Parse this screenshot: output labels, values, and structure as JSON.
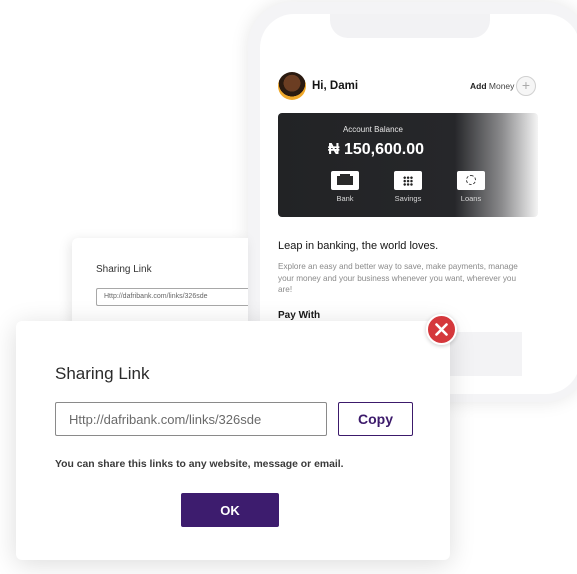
{
  "phone": {
    "greeting": "Hi, Dami",
    "add_money_bold": "Add",
    "add_money_rest": " Money",
    "plus_icon": "+",
    "balance_label": "Account Balance",
    "balance_amount": "₦ 150,600.00",
    "actions": [
      {
        "label": "Bank",
        "icon": "bank-icon"
      },
      {
        "label": "Savings",
        "icon": "grid-icon"
      },
      {
        "label": "Loans",
        "icon": "loading-icon"
      }
    ],
    "tagline": "Leap in banking, the world loves.",
    "description": "Explore an easy and better way to save, make payments, manage your money and your business whenever you want, wherever you are!",
    "pay_with": "Pay With"
  },
  "back_dialog": {
    "title": "Sharing Link",
    "link": "Http://dafribank.com/links/326sde"
  },
  "dialog": {
    "title": "Sharing Link",
    "link_value": "Http://dafribank.com/links/326sde",
    "copy_label": "Copy",
    "note": "You can share this links to any website, message or email.",
    "ok_label": "OK"
  },
  "colors": {
    "brand_purple": "#3d1c6e",
    "close_red": "#d5383c",
    "card_dark": "#222325"
  }
}
